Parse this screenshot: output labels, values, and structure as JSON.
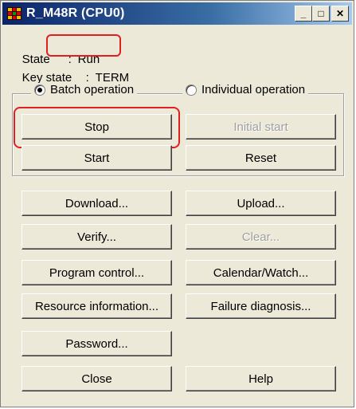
{
  "window": {
    "title": "R_M48R (CPU0)",
    "controls": {
      "minimize": "_",
      "maximize": "□",
      "close": "✕"
    }
  },
  "status": {
    "state_label": "State",
    "state_sep": ":",
    "state_value": "Run",
    "key_label": "Key state",
    "key_sep": ":",
    "key_value": "TERM"
  },
  "mode": {
    "batch_label": "Batch operation",
    "individual_label": "Individual operation",
    "selected": "batch"
  },
  "buttons": {
    "stop": "Stop",
    "initial_start": "Initial start",
    "start": "Start",
    "reset": "Reset",
    "download": "Download...",
    "upload": "Upload...",
    "verify": "Verify...",
    "clear": "Clear...",
    "program_control": "Program control...",
    "calendar_watch": "Calendar/Watch...",
    "resource_info": "Resource information...",
    "failure_diagnosis": "Failure diagnosis...",
    "password": "Password...",
    "close": "Close",
    "help": "Help"
  },
  "colors": {
    "highlight": "#e02020",
    "title_bar": "#0a246a"
  }
}
